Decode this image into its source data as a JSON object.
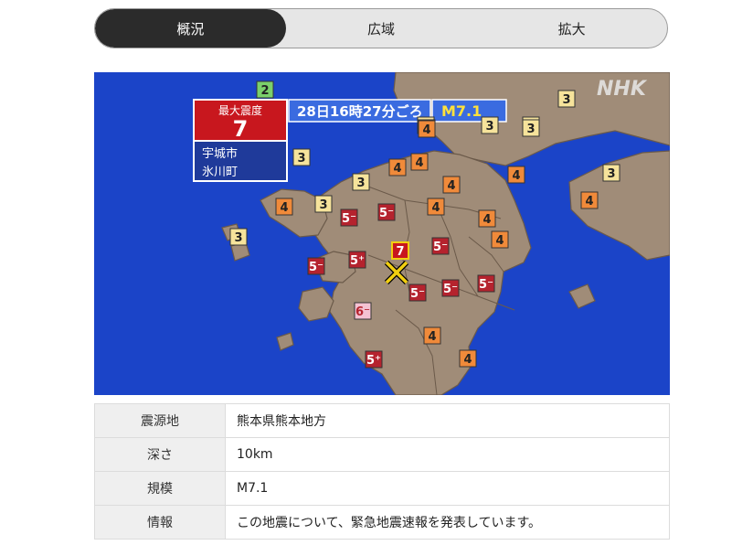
{
  "tabs": [
    {
      "label": "概況",
      "active": true
    },
    {
      "label": "広域",
      "active": false
    },
    {
      "label": "拡大",
      "active": false
    }
  ],
  "map": {
    "logo": "NHK",
    "max_intensity_label": "最大震度",
    "max_intensity_value": "7",
    "locations": [
      "宇城市",
      "氷川町"
    ],
    "time_text": "28日16時27分ごろ",
    "magnitude_text": "M7.1",
    "epicenter_icon": "x-mark-icon",
    "intensity_markers": [
      "2",
      "3",
      "3",
      "3",
      "3",
      "3",
      "3",
      "3",
      "3",
      "3",
      "3",
      "3",
      "4",
      "4",
      "4",
      "4",
      "4",
      "4",
      "4",
      "4",
      "4",
      "4",
      "4",
      "4",
      "5-",
      "5-",
      "5-",
      "5-",
      "5-",
      "5-",
      "5-",
      "5+",
      "5+",
      "6-",
      "7"
    ],
    "colors": {
      "sea": "#1b44c8",
      "land": "#a08c78",
      "i2": "#7bd06b",
      "i3": "#f6e39b",
      "i4": "#f08a3a",
      "i5": "#b5232e",
      "i6m": "#f4c2d2",
      "i7": "#c8171e"
    }
  },
  "info": [
    {
      "key": "震源地",
      "value": "熊本県熊本地方"
    },
    {
      "key": "深さ",
      "value": "10km"
    },
    {
      "key": "規模",
      "value": "M7.1"
    },
    {
      "key": "情報",
      "value": "この地震について、緊急地震速報を発表しています。"
    }
  ]
}
